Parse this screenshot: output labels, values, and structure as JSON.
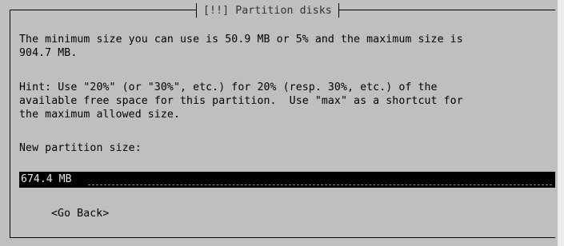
{
  "dialog": {
    "title": "[!!] Partition disks",
    "message_line1": "The minimum size you can use is 50.9 MB or 5% and the maximum size is",
    "message_line2": "904.7 MB.",
    "hint_line1": "Hint: Use \"20%\" (or \"30%\", etc.) for 20% (resp. 30%, etc.) of the",
    "hint_line2": "available free space for this partition.  Use \"max\" as a shortcut for",
    "hint_line3": "the maximum allowed size.",
    "field_label": "New partition size:",
    "field_value": "674.4 MB",
    "go_back_label": "<Go Back>"
  },
  "colors": {
    "background": "#bfbfbf",
    "field_background": "#000000",
    "field_text": "#e6e6e6"
  }
}
